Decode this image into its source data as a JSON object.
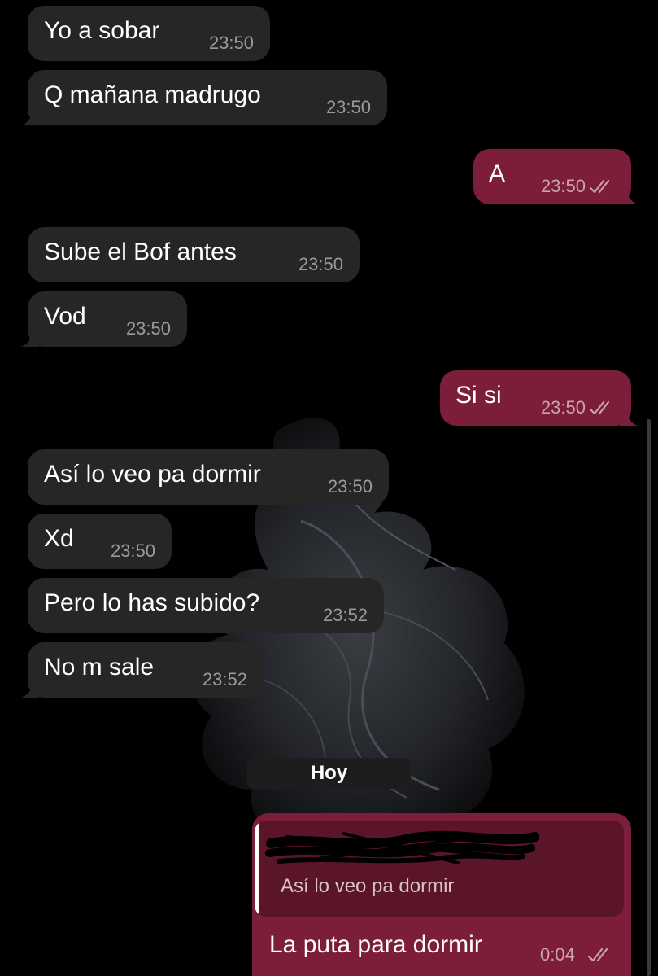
{
  "chat": {
    "date_divider": "Hoy",
    "messages": [
      {
        "direction": "in",
        "text": "Yo a sobar",
        "time": "23:50"
      },
      {
        "direction": "in",
        "text": "Q mañana madrugo",
        "time": "23:50"
      },
      {
        "direction": "out",
        "text": "A",
        "time": "23:50",
        "status": "read"
      },
      {
        "direction": "in",
        "text": "Sube el Bof antes",
        "time": "23:50"
      },
      {
        "direction": "in",
        "text": "Vod",
        "time": "23:50"
      },
      {
        "direction": "out",
        "text": "Si si",
        "time": "23:50",
        "status": "read"
      },
      {
        "direction": "in",
        "text": "Así lo veo pa dormir",
        "time": "23:50"
      },
      {
        "direction": "in",
        "text": "Xd",
        "time": "23:50"
      },
      {
        "direction": "in",
        "text": "Pero lo has subido?",
        "time": "23:52"
      },
      {
        "direction": "in",
        "text": "No m sale",
        "time": "23:52"
      }
    ],
    "reply_message": {
      "direction": "out",
      "quoted_text": "Así lo veo pa dormir",
      "quoted_sender": "redacted",
      "text": "La puta para dormir",
      "time": "0:04",
      "status": "read"
    }
  },
  "colors": {
    "background": "#000000",
    "incoming_bubble": "#262626",
    "outgoing_bubble": "#7c1d39",
    "quote_background": "#5b1529"
  },
  "icons": {
    "read_receipt": "double-check-icon",
    "wallpaper": "betta-fish-wallpaper"
  }
}
